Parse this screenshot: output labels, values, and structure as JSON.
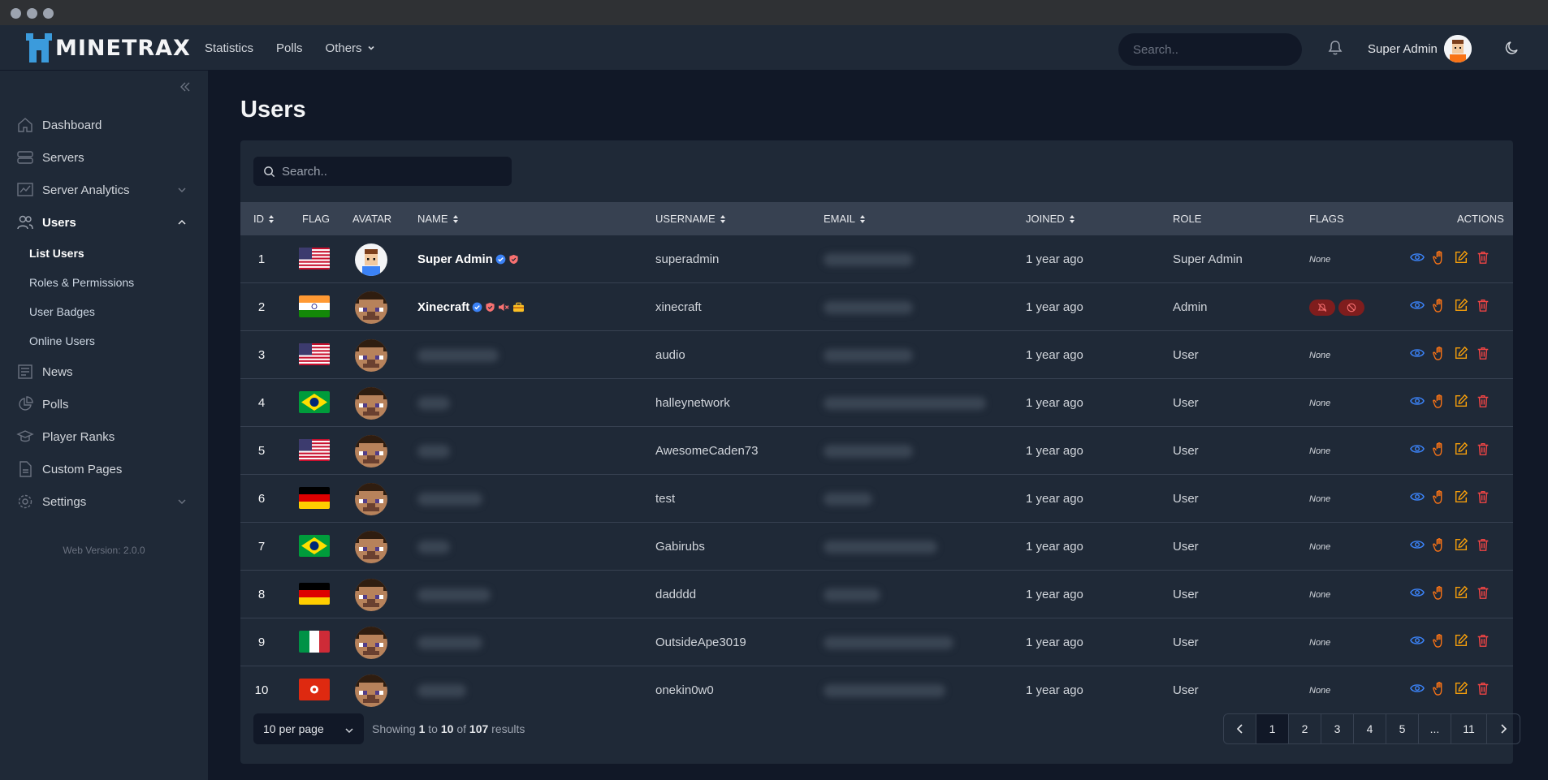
{
  "brand": {
    "name": "MINETRAX",
    "accent": "#3b9bdc"
  },
  "topnav": {
    "statistics": "Statistics",
    "polls": "Polls",
    "others": "Others"
  },
  "header": {
    "search_placeholder": "Search..",
    "user_name": "Super Admin"
  },
  "sidebar": {
    "items": [
      {
        "label": "Dashboard",
        "icon": "home-icon"
      },
      {
        "label": "Servers",
        "icon": "server-icon"
      },
      {
        "label": "Server Analytics",
        "icon": "analytics-icon"
      },
      {
        "label": "Users",
        "icon": "users-icon"
      },
      {
        "label": "News",
        "icon": "news-icon"
      },
      {
        "label": "Polls",
        "icon": "pie-icon"
      },
      {
        "label": "Player Ranks",
        "icon": "rank-icon"
      },
      {
        "label": "Custom Pages",
        "icon": "page-icon"
      },
      {
        "label": "Settings",
        "icon": "gear-icon"
      }
    ],
    "users_sub": [
      "List Users",
      "Roles & Permissions",
      "User Badges",
      "Online Users"
    ],
    "version": "Web Version: 2.0.0"
  },
  "page": {
    "title": "Users"
  },
  "table": {
    "search_placeholder": "Search..",
    "headers": {
      "id": "ID",
      "flag": "FLAG",
      "avatar": "AVATAR",
      "name": "NAME",
      "username": "USERNAME",
      "email": "EMAIL",
      "joined": "JOINED",
      "role": "ROLE",
      "flags": "FLAGS",
      "actions": "ACTIONS"
    },
    "rows": [
      {
        "id": "1",
        "country": "us",
        "name": "Super Admin",
        "username": "superadmin",
        "joined": "1 year ago",
        "role": "Super Admin",
        "flags": "None"
      },
      {
        "id": "2",
        "country": "in",
        "name": "Xinecraft",
        "username": "xinecraft",
        "joined": "1 year ago",
        "role": "Admin",
        "flags": ""
      },
      {
        "id": "3",
        "country": "us",
        "name": "",
        "username": "audio",
        "joined": "1 year ago",
        "role": "User",
        "flags": "None"
      },
      {
        "id": "4",
        "country": "br",
        "name": "",
        "username": "halleynetwork",
        "joined": "1 year ago",
        "role": "User",
        "flags": "None"
      },
      {
        "id": "5",
        "country": "us",
        "name": "",
        "username": "AwesomeCaden73",
        "joined": "1 year ago",
        "role": "User",
        "flags": "None"
      },
      {
        "id": "6",
        "country": "de",
        "name": "",
        "username": "test",
        "joined": "1 year ago",
        "role": "User",
        "flags": "None"
      },
      {
        "id": "7",
        "country": "br",
        "name": "",
        "username": "Gabirubs",
        "joined": "1 year ago",
        "role": "User",
        "flags": "None"
      },
      {
        "id": "8",
        "country": "de",
        "name": "",
        "username": "dadddd",
        "joined": "1 year ago",
        "role": "User",
        "flags": "None"
      },
      {
        "id": "9",
        "country": "it",
        "name": "",
        "username": "OutsideApe3019",
        "joined": "1 year ago",
        "role": "User",
        "flags": "None"
      },
      {
        "id": "10",
        "country": "hk",
        "name": "",
        "username": "onekin0w0",
        "joined": "1 year ago",
        "role": "User",
        "flags": "None"
      }
    ]
  },
  "footer": {
    "per_page": "10 per page",
    "showing_prefix": "Showing",
    "from": "1",
    "to_word": "to",
    "to": "10",
    "of_word": "of",
    "total": "107",
    "results_word": "results",
    "pages": [
      "1",
      "2",
      "3",
      "4",
      "5",
      "...",
      "11"
    ]
  },
  "colors": {
    "view": "#3b82f6",
    "impersonate": "#f97316",
    "edit": "#f59e0b",
    "delete": "#ef4444",
    "verified": "#3b82f6",
    "badge": "#f87171"
  }
}
